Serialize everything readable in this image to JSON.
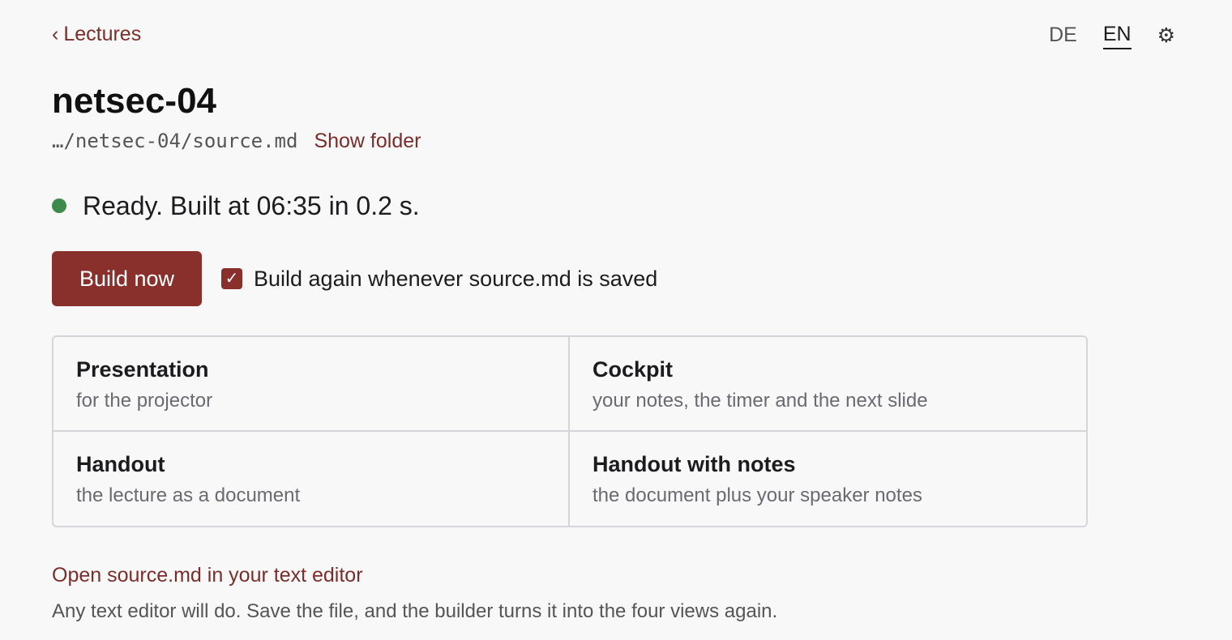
{
  "nav": {
    "back_chevron": "‹",
    "back_label": "Lectures"
  },
  "language": {
    "options": [
      "DE",
      "EN"
    ],
    "selected": "EN"
  },
  "settings": {
    "icon": "gear-icon",
    "glyph": "⚙"
  },
  "lecture": {
    "title": "netsec-04",
    "path": "…/netsec-04/source.md",
    "show_folder_label": "Show folder"
  },
  "status": {
    "state": "ready",
    "color": "#3d8a4a",
    "text": "Ready. Built at 06:35 in 0.2 s."
  },
  "actions": {
    "build_label": "Build now",
    "auto_build_label": "Build again whenever source.md is saved",
    "auto_build_checked": true,
    "check_glyph": "✓"
  },
  "views": [
    {
      "name": "Presentation",
      "description": "for the projector"
    },
    {
      "name": "Cockpit",
      "description": "your notes, the timer and the next slide"
    },
    {
      "name": "Handout",
      "description": "the lecture as a document"
    },
    {
      "name": "Handout with notes",
      "description": "the document plus your speaker notes"
    }
  ],
  "editor": {
    "open_label": "Open source.md in your text editor",
    "hint": "Any text editor will do. Save the file, and the builder turns it into the four views again."
  },
  "colors": {
    "accent": "#8a302c",
    "link": "#7a2e2a",
    "status_ok": "#3d8a4a"
  }
}
